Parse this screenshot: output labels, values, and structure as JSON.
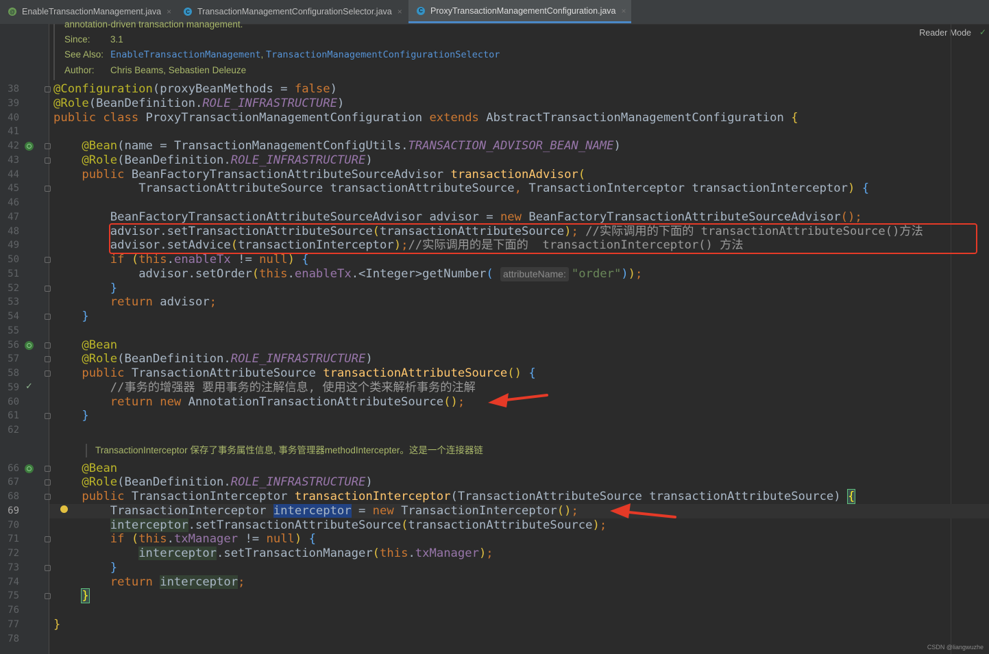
{
  "tabs": [
    {
      "label": "EnableTransactionManagement.java",
      "icon": "annotation-icon",
      "active": false
    },
    {
      "label": "TransactionManagementConfigurationSelector.java",
      "icon": "class-icon",
      "active": false
    },
    {
      "label": "ProxyTransactionManagementConfiguration.java",
      "icon": "class-icon",
      "active": true
    }
  ],
  "tab_close_glyph": "×",
  "reader_mode_label": "Reader Mode",
  "doc": {
    "summary_tail": "annotation-driven transaction management.",
    "since_label": "Since:",
    "since_value": "3.1",
    "see_also_label": "See Also:",
    "see_also_link1": "EnableTransactionManagement",
    "see_also_sep": ", ",
    "see_also_link2": "TransactionManagementConfigurationSelector",
    "author_label": "Author:",
    "author_value": "Chris Beams, Sebastien Deleuze"
  },
  "line_numbers": [
    "38",
    "39",
    "40",
    "41",
    "42",
    "43",
    "44",
    "45",
    "46",
    "47",
    "48",
    "49",
    "50",
    "51",
    "52",
    "53",
    "54",
    "55",
    "56",
    "57",
    "58",
    "59",
    "60",
    "61",
    "62",
    "66",
    "67",
    "68",
    "69",
    "70",
    "71",
    "72",
    "73",
    "74",
    "75",
    "76",
    "77",
    "78"
  ],
  "current_line": "69",
  "code": {
    "l38": {
      "a": "@Configuration",
      "b": "(proxyBeanMethods = ",
      "c": "false",
      "d": ")"
    },
    "l39": {
      "a": "@Role",
      "b": "(BeanDefinition.",
      "c": "ROLE_INFRASTRUCTURE",
      "d": ")"
    },
    "l40": {
      "a": "public class ",
      "b": "ProxyTransactionManagementConfiguration ",
      "c": "extends ",
      "d": "AbstractTransactionManagementConfiguration ",
      "e": "{"
    },
    "l42": {
      "a": "@Bean",
      "b": "(name = TransactionManagementConfigUtils.",
      "c": "TRANSACTION_ADVISOR_BEAN_NAME",
      "d": ")"
    },
    "l43": {
      "a": "@Role",
      "b": "(BeanDefinition.",
      "c": "ROLE_INFRASTRUCTURE",
      "d": ")"
    },
    "l44": {
      "a": "public ",
      "b": "BeanFactoryTransactionAttributeSourceAdvisor ",
      "c": "transactionAdvisor",
      "d": "("
    },
    "l45": {
      "a": "TransactionAttributeSource transactionAttributeSource",
      "b": ", ",
      "c": "TransactionInterceptor transactionInterceptor",
      "d": ") ",
      "e": "{"
    },
    "l47": {
      "a": "BeanFactoryTransactionAttributeSourceAdvisor advisor = ",
      "b": "new ",
      "c": "BeanFactoryTransactionAttributeSourceAdvisor",
      "d": "();"
    },
    "l48": {
      "a": "advisor.setTransactionAttributeSource",
      "b": "(",
      "c": "transactionAttributeSource",
      "d": ")",
      "e": "; ",
      "f": "//实际调用的下面的 transactionAttributeSource()方法"
    },
    "l49": {
      "a": "advisor.setAdvice",
      "b": "(",
      "c": "transactionInterceptor",
      "d": ")",
      "e": ";",
      "f": "//实际调用的是下面的  transactionInterceptor() 方法"
    },
    "l50": {
      "a": "if ",
      "b": "(",
      "c": "this",
      "d": ".",
      "e": "enableTx ",
      "f": "!= ",
      "g": "null",
      "h": ") ",
      "i": "{"
    },
    "l51": {
      "a": "advisor.setOrder",
      "b": "(",
      "c": "this",
      "d": ".",
      "e": "enableTx",
      "f": ".<Integer>",
      "g": "getNumber",
      "h": "(",
      "hint": "attributeName:",
      "s": "\"order\"",
      "i": ")",
      "j": ")",
      "k": ";"
    },
    "l52": {
      "a": "}"
    },
    "l53": {
      "a": "return ",
      "b": "advisor",
      "c": ";"
    },
    "l54": {
      "a": "}"
    },
    "l56": {
      "a": "@Bean"
    },
    "l57": {
      "a": "@Role",
      "b": "(BeanDefinition.",
      "c": "ROLE_INFRASTRUCTURE",
      "d": ")"
    },
    "l58": {
      "a": "public ",
      "b": "TransactionAttributeSource ",
      "c": "transactionAttributeSource",
      "d": "() ",
      "e": "{"
    },
    "l59": {
      "a": "//事务的增强器 要用事务的注解信息, 使用这个类来解析事务的注解"
    },
    "l60": {
      "a": "return new ",
      "b": "AnnotationTransactionAttributeSource",
      "c": "()",
      "d": ";"
    },
    "l61": {
      "a": "}"
    },
    "inlay": "TransactionInterceptor 保存了事务属性信息, 事务管理器methodIntercepter。这是一个连接器链",
    "l66": {
      "a": "@Bean"
    },
    "l67": {
      "a": "@Role",
      "b": "(BeanDefinition.",
      "c": "ROLE_INFRASTRUCTURE",
      "d": ")"
    },
    "l68": {
      "a": "public ",
      "b": "TransactionInterceptor ",
      "c": "transactionInterceptor",
      "d": "(TransactionAttributeSource transactionAttributeSource) ",
      "e": "{"
    },
    "l69": {
      "a": "TransactionInterceptor ",
      "b": "interceptor",
      "c": " = ",
      "d": "new ",
      "e": "TransactionInterceptor",
      "f": "()",
      "g": ";"
    },
    "l70": {
      "a": "interceptor",
      "b": ".setTransactionAttributeSource",
      "c": "(",
      "d": "transactionAttributeSource",
      "e": ")",
      "f": ";"
    },
    "l71": {
      "a": "if ",
      "b": "(",
      "c": "this",
      "d": ".",
      "e": "txManager ",
      "f": "!= ",
      "g": "null",
      "h": ") ",
      "i": "{"
    },
    "l72": {
      "a": "interceptor",
      "b": ".setTransactionManager",
      "c": "(",
      "d": "this",
      "e": ".",
      "f": "txManager",
      "g": ")",
      "h": ";"
    },
    "l73": {
      "a": "}"
    },
    "l74": {
      "a": "return ",
      "b": "interceptor",
      "c": ";"
    },
    "l75": {
      "a": "}"
    },
    "l77": {
      "a": "}"
    }
  },
  "watermark": "CSDN @liangwuzhe",
  "colors": {
    "background": "#2b2b2b",
    "annotation": "#bbb529",
    "keyword": "#cc7832",
    "method_decl": "#ffc66d",
    "static_field": "#9876aa",
    "string": "#6a8759",
    "highlight_box": "#e53a27"
  }
}
